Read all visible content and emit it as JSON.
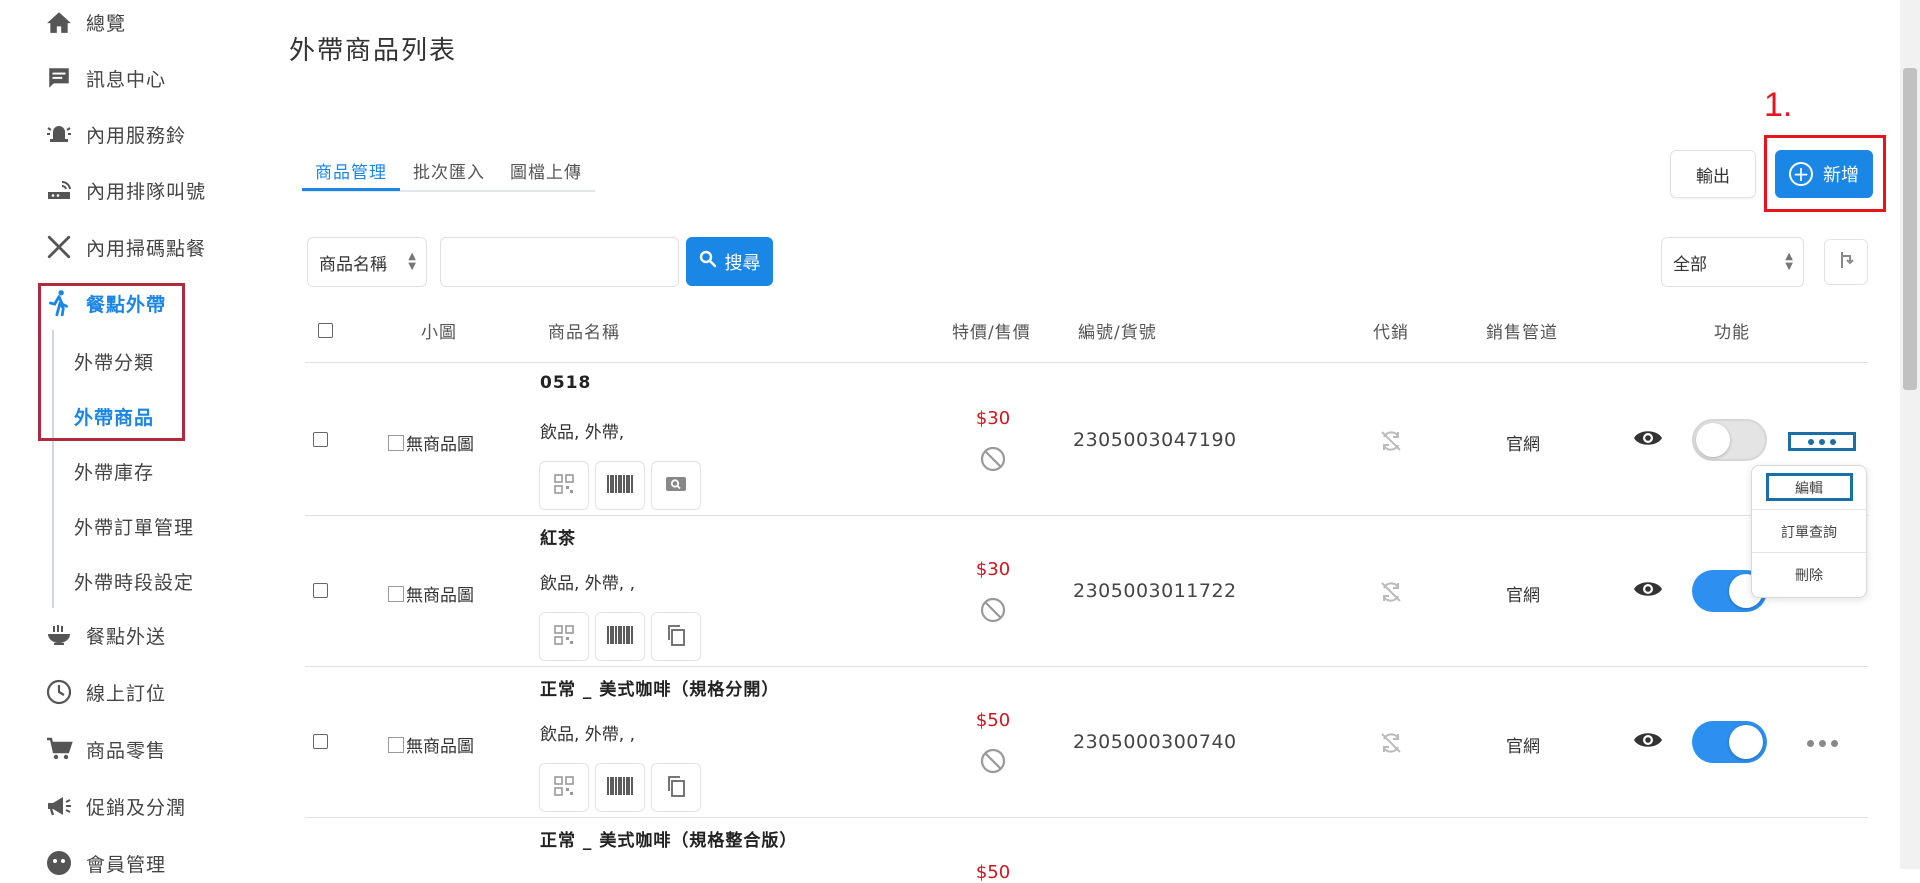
{
  "sidebar": {
    "items": [
      {
        "label": "總覽",
        "icon": "home-icon"
      },
      {
        "label": "訊息中心",
        "icon": "message-icon"
      },
      {
        "label": "內用服務鈴",
        "icon": "bell-icon"
      },
      {
        "label": "內用排隊叫號",
        "icon": "router-icon"
      },
      {
        "label": "內用掃碼點餐",
        "icon": "utensils-icon"
      },
      {
        "label": "餐點外帶",
        "icon": "walking-icon"
      },
      {
        "label": "餐點外送",
        "icon": "bowl-icon"
      },
      {
        "label": "線上訂位",
        "icon": "clock-icon"
      },
      {
        "label": "商品零售",
        "icon": "cart-icon"
      },
      {
        "label": "促銷及分潤",
        "icon": "megaphone-icon"
      },
      {
        "label": "會員管理",
        "icon": "member-icon"
      }
    ],
    "active_item": "餐點外帶",
    "subitems": [
      {
        "label": "外帶分類"
      },
      {
        "label": "外帶商品"
      },
      {
        "label": "外帶庫存"
      },
      {
        "label": "外帶訂單管理"
      },
      {
        "label": "外帶時段設定"
      }
    ],
    "active_subitem": "外帶商品"
  },
  "page": {
    "title": "外帶商品列表"
  },
  "annotation": {
    "step_label": "1."
  },
  "tabs": [
    {
      "label": "商品管理"
    },
    {
      "label": "批次匯入"
    },
    {
      "label": "圖檔上傳"
    }
  ],
  "toolbar": {
    "export_label": "輸出",
    "add_label": "新增"
  },
  "search": {
    "field_selected": "商品名稱",
    "query": "",
    "button_label": "搜尋"
  },
  "filter": {
    "status_selected": "全部"
  },
  "table": {
    "columns": [
      "小圖",
      "商品名稱",
      "特價/售價",
      "編號/貨號",
      "代銷",
      "銷售管道",
      "功能"
    ],
    "rows": [
      {
        "name": "0518",
        "category": "飲品, 外帶,",
        "image_alt": "無商品圖",
        "price": "$30",
        "code": "2305003047190",
        "channel": "官網",
        "enabled": false
      },
      {
        "name": "紅茶",
        "category": "飲品, 外帶, ,",
        "image_alt": "無商品圖",
        "price": "$30",
        "code": "2305003011722",
        "channel": "官網",
        "enabled": true
      },
      {
        "name": "正常 _ 美式咖啡（規格分開）",
        "category": "飲品, 外帶, ,",
        "image_alt": "無商品圖",
        "price": "$50",
        "code": "2305000300740",
        "channel": "官網",
        "enabled": true
      },
      {
        "name": "正常 _ 美式咖啡（規格整合版）",
        "price": "$50"
      }
    ]
  },
  "row_menu": {
    "items": [
      "編輯",
      "訂單查詢",
      "刪除"
    ]
  },
  "colors": {
    "accent": "#1a86e6",
    "price": "#d0161e",
    "annotation_red": "#e8141c",
    "nav_box": "#b22a3a",
    "edit_box": "#1b6fa8"
  }
}
